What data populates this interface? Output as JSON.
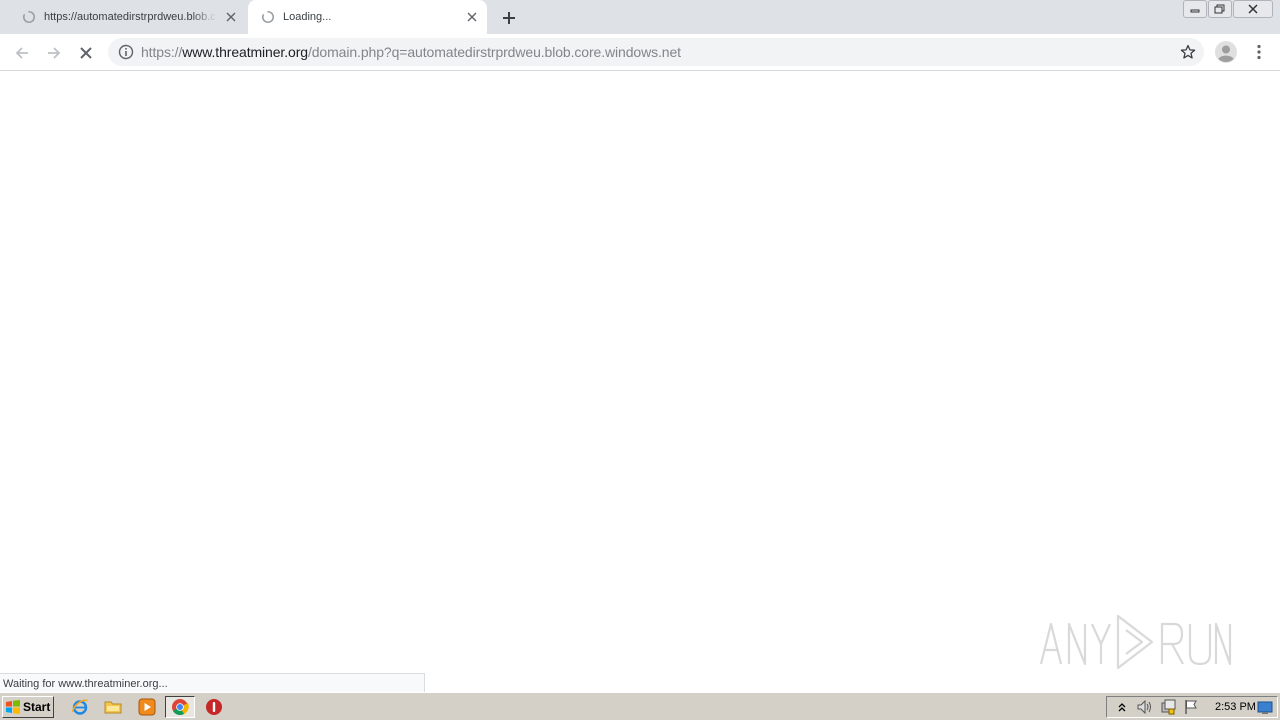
{
  "tabs": [
    {
      "title": "https://automatedirstrprdweu.blob.core.windows.net",
      "active": false,
      "loading": true
    },
    {
      "title": "Loading...",
      "active": true,
      "loading": true
    }
  ],
  "address_bar": {
    "scheme": "https://",
    "host": "www.threatminer.org",
    "path": "/domain.php?q=automatedirstrprdweu.blob.core.windows.net"
  },
  "status_bubble": "Waiting for www.threatminer.org...",
  "watermark": "ANY RUN",
  "taskbar": {
    "start_label": "Start",
    "quick_launch": [
      "internet-explorer-icon",
      "folder-icon",
      "media-player-icon",
      "chrome-icon",
      "stop-icon"
    ],
    "tray_icons": [
      "show-hidden-icon",
      "volume-icon",
      "network-icon",
      "action-center-flag-icon"
    ],
    "clock": "2:53 PM"
  },
  "colors": {
    "tabstrip": "#dee1e6",
    "omnibox": "#f1f3f4",
    "taskbar": "#d4d0c8",
    "spinner": "#1a73e8"
  }
}
